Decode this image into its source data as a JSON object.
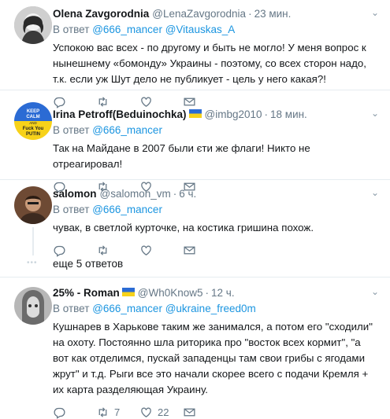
{
  "tweets": [
    {
      "name": "Olena Zavgorodnia",
      "handle": "@LenaZavgorodnia",
      "time": "23 мин.",
      "reply_prefix": "В ответ",
      "reply_to": [
        "@666_mancer",
        "@Vitauskas_A"
      ],
      "text": "Успокою вас всех - по другому и быть не могло! У меня вопрос к нынешнему «бомонду» Украины - поэтому, со всех сторон надо, т.к. если уж Шут дело не публикует - цель у него какая?!"
    },
    {
      "name": "Irina Petroff(Beduinochka)",
      "handle": "@imbg2010",
      "time": "18 мин.",
      "reply_prefix": "В ответ",
      "reply_to": [
        "@666_mancer"
      ],
      "text": "Так на Майдане в 2007 были єти же флаги! Никто не отреагировал!",
      "avatar_text": [
        "KEEP",
        "CALM",
        "AND",
        "Fuck You",
        "PUTIN"
      ]
    },
    {
      "name": "salomon",
      "handle": "@salomon_vm",
      "time": "6 ч.",
      "reply_prefix": "В ответ",
      "reply_to": [
        "@666_mancer"
      ],
      "text": "чувак, в светлой курточке, на костика гришина похож.",
      "more_replies": "еще 5 ответов"
    },
    {
      "name": "25% - Roman",
      "handle": "@Wh0Know5",
      "time": "12 ч.",
      "reply_prefix": "В ответ",
      "reply_to": [
        "@666_mancer",
        "@ukraine_freed0m"
      ],
      "text": "Кушнарев в Харькове таким же занимался, а потом его \"сходили\" на охоту. Постоянно шла риторика про \"восток всех кормит\", \"а вот как отделимся, пускай западенцы там свои грибы с ягодами жрут\" и т.д. Рыги все это начали скорее всего с подачи Кремля + их карта разделяющая Украину.",
      "retweets": "7",
      "likes": "22"
    }
  ],
  "colors": {
    "link": "#1b95e0",
    "muted": "#657786",
    "like": "#657786"
  },
  "icons": {
    "reply": "reply-icon",
    "retweet": "retweet-icon",
    "like": "heart-icon",
    "mail": "mail-icon",
    "more": "chevron-down-icon"
  }
}
